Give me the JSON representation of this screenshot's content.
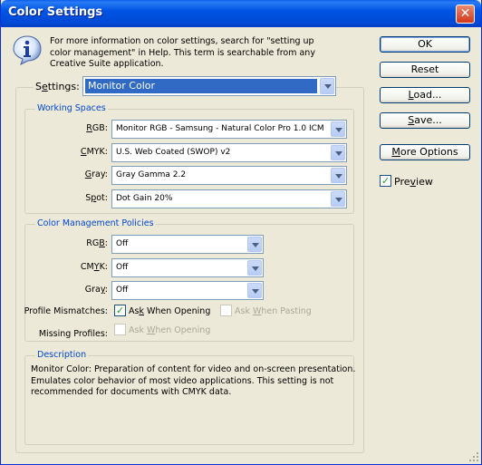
{
  "window": {
    "title": "Color Settings",
    "close_label": "✕"
  },
  "info": {
    "text": "For more information on color settings, search for \"setting up color management\" in Help. This term is searchable from any Creative Suite application."
  },
  "settings": {
    "label_prefix": "S",
    "label_underlined": "e",
    "label_suffix": "ttings:",
    "value": "Monitor Color"
  },
  "working_spaces": {
    "title": "Working Spaces",
    "rgb": {
      "label_u": "R",
      "label_rest": "GB:",
      "value": "Monitor RGB - Samsung - Natural Color Pro 1.0 ICM"
    },
    "cmyk": {
      "label_u": "C",
      "label_rest": "MYK:",
      "value": "U.S. Web Coated (SWOP) v2"
    },
    "gray": {
      "label_u": "G",
      "label_rest": "ray:",
      "value": "Gray Gamma 2.2"
    },
    "spot": {
      "label_pre": "S",
      "label_u": "p",
      "label_rest": "ot:",
      "value": "Dot Gain 20%"
    }
  },
  "policies": {
    "title": "Color Management Policies",
    "rgb": {
      "label_pre": "RG",
      "label_u": "B",
      "label_rest": ":",
      "value": "Off"
    },
    "cmyk": {
      "label_pre": "CM",
      "label_u": "Y",
      "label_rest": "K:",
      "value": "Off"
    },
    "gray": {
      "label_pre": "Gra",
      "label_u": "y",
      "label_rest": ":",
      "value": "Off"
    },
    "profile_mismatches": {
      "label": "Profile Mismatches:",
      "ask_opening": {
        "label_pre": "As",
        "label_u": "k",
        "label_rest": " When Opening",
        "checked": true
      },
      "ask_pasting": {
        "label_pre": "Ask ",
        "label_u": "W",
        "label_rest": "hen Pasting",
        "checked": false
      }
    },
    "missing_profiles": {
      "label": "Missing Profiles:",
      "ask_opening": {
        "label_pre": "Ask ",
        "label_u": "W",
        "label_rest": "hen Opening",
        "checked": false
      }
    }
  },
  "description": {
    "title": "Description",
    "text": "Monitor Color:  Preparation of content for video and on-screen presentation. Emulates color behavior of most video applications. This setting is not recommended for documents with CMYK data."
  },
  "buttons": {
    "ok": "OK",
    "reset": "Reset",
    "load_pre": "",
    "load_u": "L",
    "load_rest": "oad...",
    "save_pre": "",
    "save_u": "S",
    "save_rest": "ave...",
    "more_options_pre": "",
    "more_options_u": "M",
    "more_options_rest": "ore Options"
  },
  "preview": {
    "label_pre": "Pre",
    "label_u": "v",
    "label_rest": "iew",
    "checked": true
  },
  "colors": {
    "titlebar": "#0054e3",
    "face": "#ece9d8",
    "group_title": "#0046d5",
    "selection": "#316ac5"
  }
}
